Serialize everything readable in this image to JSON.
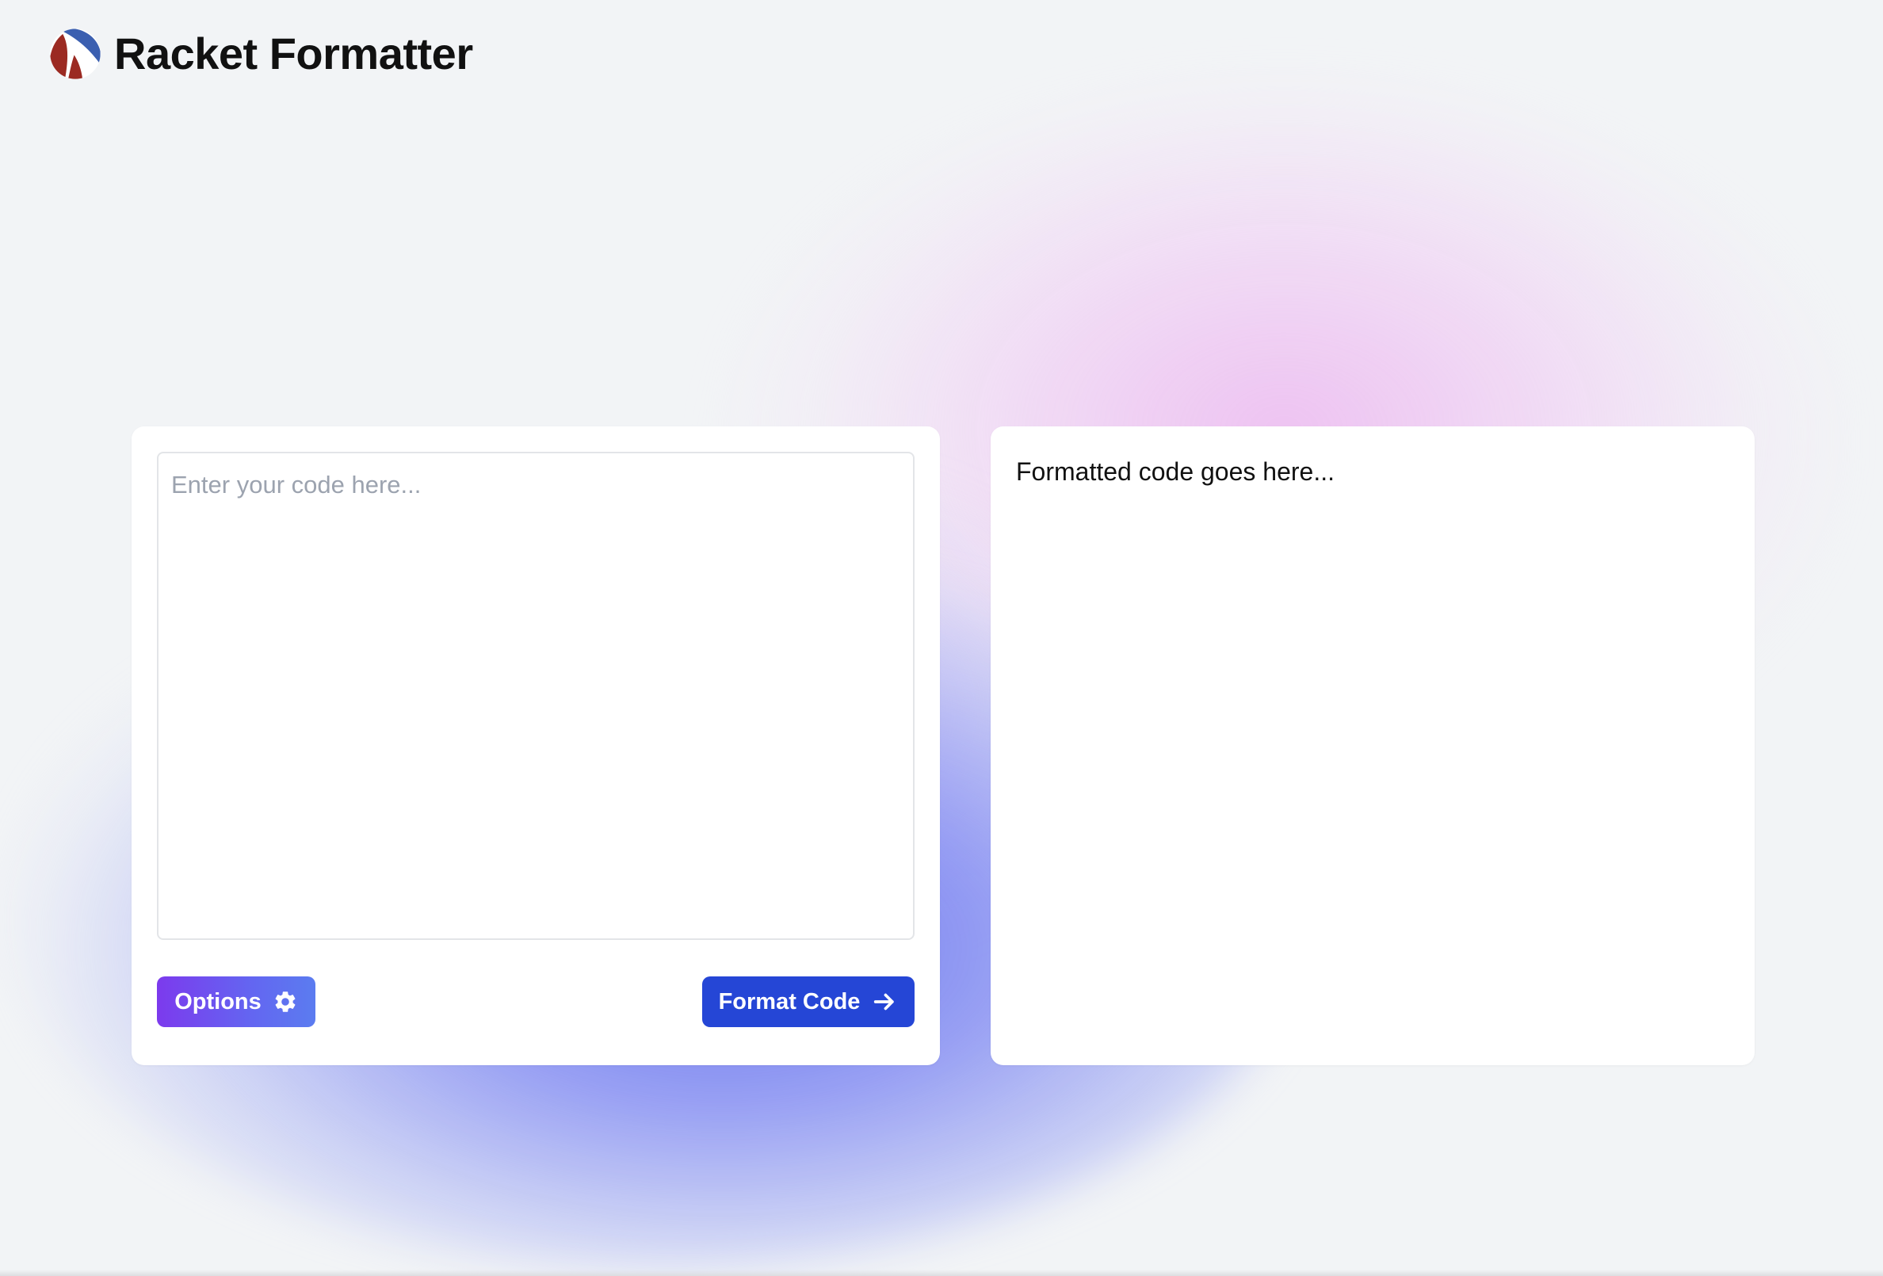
{
  "app": {
    "title": "Racket Formatter",
    "logo_icon": "racket-logo-icon"
  },
  "editor": {
    "placeholder": "Enter your code here...",
    "value": ""
  },
  "buttons": {
    "options": {
      "label": "Options",
      "icon": "gear-icon"
    },
    "format": {
      "label": "Format Code",
      "icon": "arrow-right-icon"
    }
  },
  "output": {
    "text": "Formatted code goes here..."
  },
  "colors": {
    "background": "#f2f4f6",
    "card": "#ffffff",
    "format_button": "#2546d6",
    "options_gradient_start": "#7c3aed",
    "options_gradient_end": "#5b7cf0",
    "logo_red": "#9b2a22",
    "logo_blue": "#3b5fb0"
  }
}
